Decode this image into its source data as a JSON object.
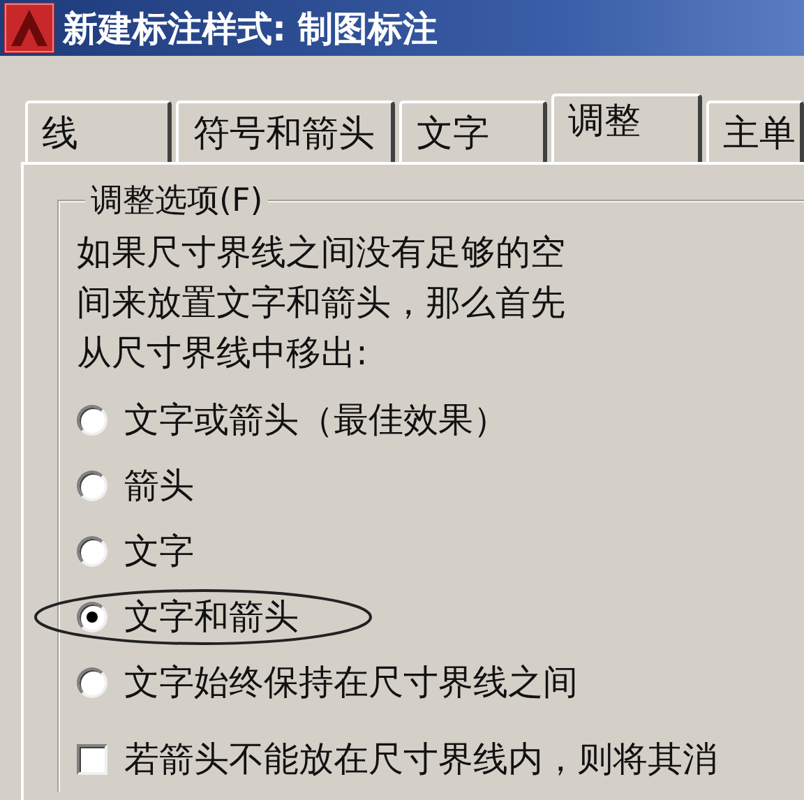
{
  "window": {
    "title": "新建标注样式: 制图标注"
  },
  "tabs": [
    {
      "label": "线",
      "selected": false
    },
    {
      "label": "符号和箭头",
      "selected": false
    },
    {
      "label": "文字",
      "selected": false
    },
    {
      "label": "调整",
      "selected": true
    },
    {
      "label": "主单",
      "selected": false
    }
  ],
  "fit_options": {
    "label": "调整选项(F)",
    "description": [
      "如果尺寸界线之间没有足够的空",
      "间来放置文字和箭头，那么首先",
      "从尺寸界线中移出:"
    ],
    "options": [
      {
        "label": "文字或箭头（最佳效果）",
        "selected": false,
        "circled": false
      },
      {
        "label": "箭头",
        "selected": false,
        "circled": false
      },
      {
        "label": "文字",
        "selected": false,
        "circled": false
      },
      {
        "label": "文字和箭头",
        "selected": true,
        "circled": true
      },
      {
        "label": "文字始终保持在尺寸界线之间",
        "selected": false,
        "circled": false
      }
    ],
    "checkbox": {
      "label": "若箭头不能放在尺寸界线内，则将其消",
      "checked": false
    }
  }
}
